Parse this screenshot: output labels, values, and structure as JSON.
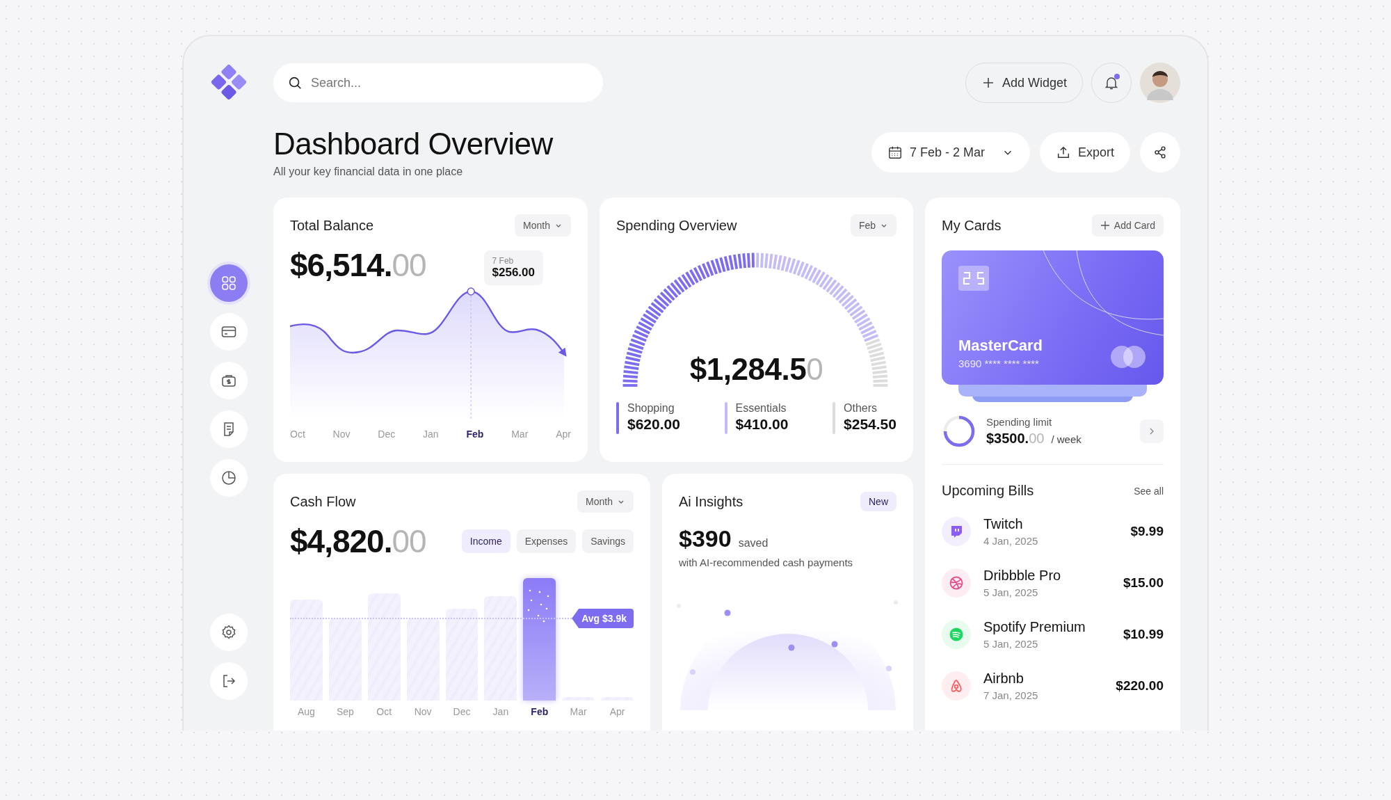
{
  "search": {
    "placeholder": "Search..."
  },
  "header_actions": {
    "add_widget": "Add Widget",
    "notification_dot": true
  },
  "sidebar": {
    "items": [
      {
        "kind": "grid",
        "selected": true
      },
      {
        "kind": "card",
        "selected": false
      },
      {
        "kind": "wallet",
        "selected": false
      },
      {
        "kind": "note",
        "selected": false
      },
      {
        "kind": "pie",
        "selected": false
      }
    ],
    "bottom_items": [
      {
        "kind": "settings"
      },
      {
        "kind": "logout"
      }
    ]
  },
  "page": {
    "title": "Dashboard Overview",
    "subtitle": "All your key financial data in one place",
    "date_range": "7 Feb - 2 Mar",
    "export": "Export"
  },
  "total_balance": {
    "title": "Total Balance",
    "period": "Month",
    "amount": "$6,514.",
    "amount_tail": "00",
    "tooltip": {
      "date": "7 Feb",
      "value": "$256.00"
    },
    "months": [
      {
        "label": "Oct",
        "selected": false
      },
      {
        "label": "Nov",
        "selected": false
      },
      {
        "label": "Dec",
        "selected": false
      },
      {
        "label": "Jan",
        "selected": false
      },
      {
        "label": "Feb",
        "selected": true
      },
      {
        "label": "Mar",
        "selected": false
      },
      {
        "label": "Apr",
        "selected": false
      }
    ]
  },
  "spending": {
    "title": "Spending Overview",
    "period": "Feb",
    "amount": "$1,284.5",
    "amount_tail": "0",
    "categories": [
      {
        "name": "Shopping",
        "value": "$620.00",
        "color": "#7b6cf0"
      },
      {
        "name": "Essentials",
        "value": "$410.00",
        "color": "#c3bcf6"
      },
      {
        "name": "Others",
        "value": "$254.50",
        "color": "#dcdcde"
      }
    ]
  },
  "my_cards": {
    "title": "My Cards",
    "add": "Add Card",
    "card": {
      "name": "MasterCard",
      "number": "3690 **** **** ****"
    },
    "limit": {
      "label": "Spending limit",
      "amount": "$3500.",
      "amount_tail": "00",
      "unit": "/ week",
      "level": 0.75
    }
  },
  "bills": {
    "title": "Upcoming Bills",
    "see_all": "See all",
    "items": [
      {
        "kind": "twitch",
        "name": "Twitch",
        "date": "4 Jan, 2025",
        "amount": "$9.99",
        "color": "#8b5cf6"
      },
      {
        "kind": "dribbble",
        "name": "Dribbble Pro",
        "date": "5 Jan, 2025",
        "amount": "$15.00",
        "color": "#ea4c89"
      },
      {
        "kind": "spotify",
        "name": "Spotify Premium",
        "date": "5 Jan, 2025",
        "amount": "$10.99",
        "color": "#1ed760"
      },
      {
        "kind": "airbnb",
        "name": "Airbnb",
        "date": "7 Jan, 2025",
        "amount": "$220.00",
        "color": "#ff5a5f"
      }
    ]
  },
  "cash_flow": {
    "title": "Cash Flow",
    "period": "Month",
    "amount": "$4,820.",
    "amount_tail": "00",
    "tabs": [
      {
        "label": "Income",
        "selected": true
      },
      {
        "label": "Expenses",
        "selected": false
      },
      {
        "label": "Savings",
        "selected": false
      }
    ],
    "average": "Avg $3.9k",
    "months": [
      {
        "label": "Aug",
        "selected": false
      },
      {
        "label": "Sep",
        "selected": false
      },
      {
        "label": "Oct",
        "selected": false
      },
      {
        "label": "Nov",
        "selected": false
      },
      {
        "label": "Dec",
        "selected": false
      },
      {
        "label": "Jan",
        "selected": false
      },
      {
        "label": "Feb",
        "selected": true
      },
      {
        "label": "Mar",
        "selected": false
      },
      {
        "label": "Apr",
        "selected": false
      }
    ]
  },
  "ai_insights": {
    "title": "Ai Insights",
    "badge": "New",
    "amount": "$390",
    "amount_note": "saved",
    "text": "with AI-recommended cash payments"
  }
}
